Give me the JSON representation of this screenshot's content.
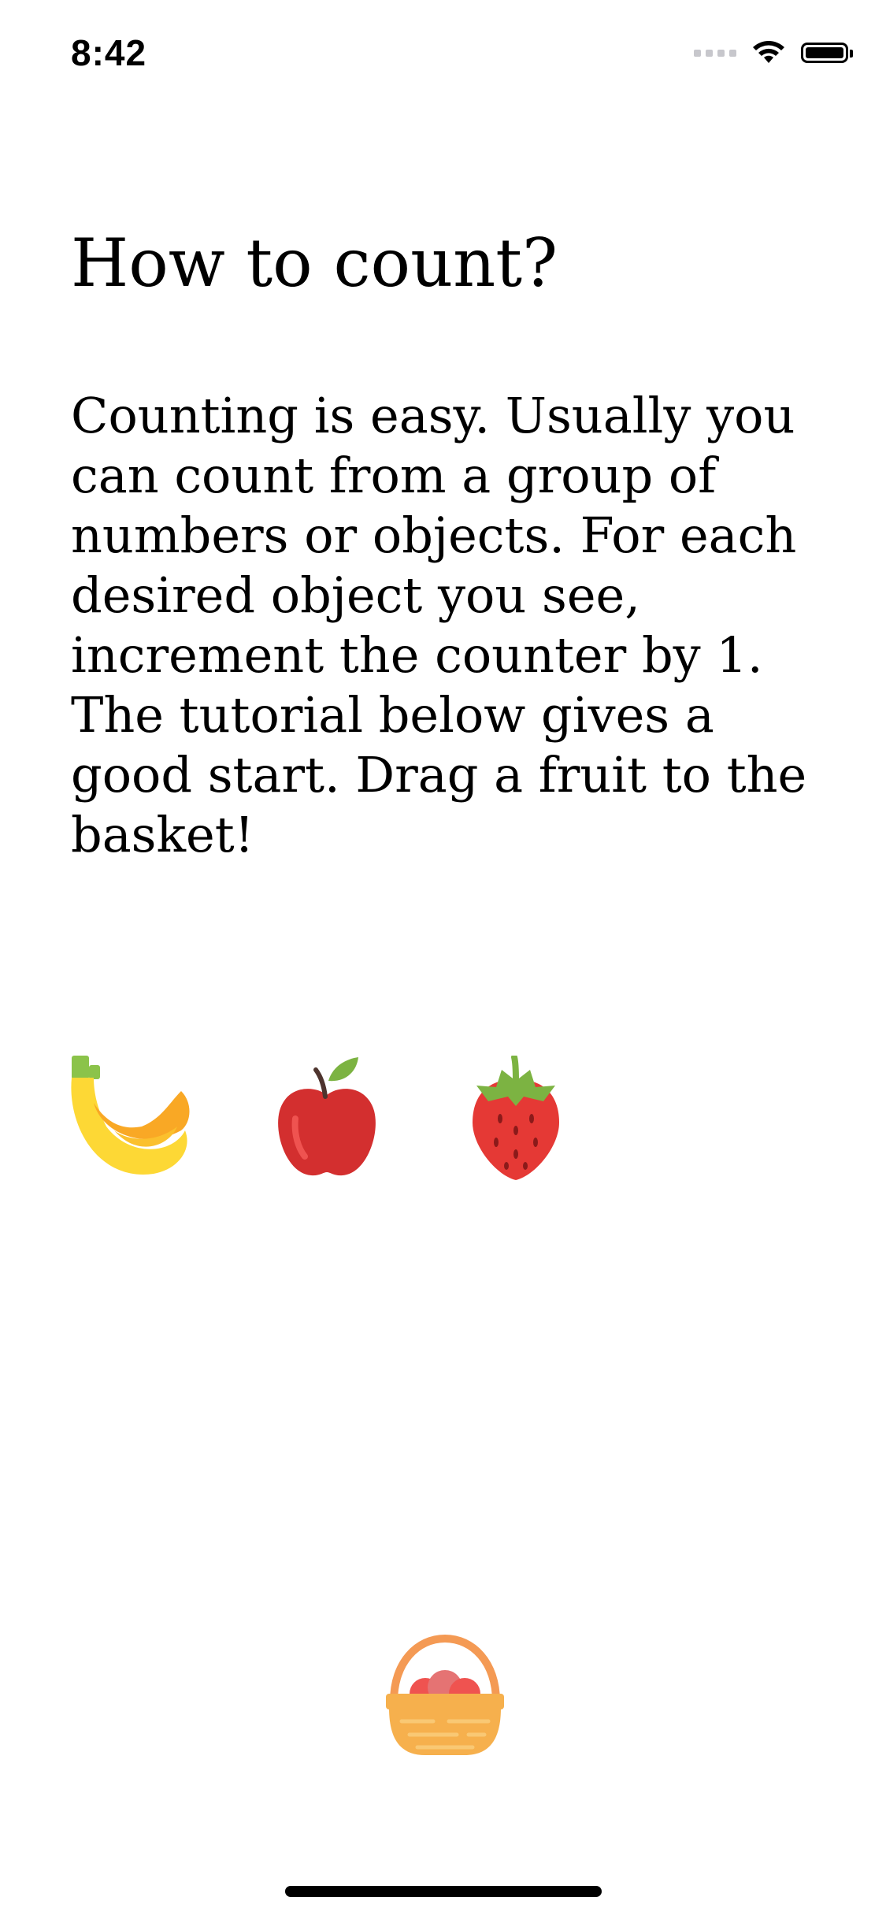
{
  "status_bar": {
    "time": "8:42",
    "icons": [
      "signal-dots-icon",
      "wifi-icon",
      "battery-icon"
    ]
  },
  "page": {
    "title": "How to count?",
    "body": "Counting is easy. Usually you can count from a group of numbers or objects. For each desired object you see, increment the counter by 1. The tutorial below gives a good start. Drag a fruit to the basket!"
  },
  "fruits": [
    {
      "name": "banana",
      "icon": "banana-icon"
    },
    {
      "name": "apple",
      "icon": "apple-icon"
    },
    {
      "name": "strawberry",
      "icon": "strawberry-icon"
    }
  ],
  "basket": {
    "icon": "basket-icon"
  },
  "colors": {
    "banana": "#fdd835",
    "banana_shade": "#f9a825",
    "banana_stem": "#8bc34a",
    "apple": "#d32f2f",
    "apple_leaf": "#7cb342",
    "strawberry": "#e53935",
    "strawberry_leaf": "#7cb342",
    "basket": "#f6b04d",
    "basket_handle": "#f49a54",
    "basket_fruit": "#ef5350"
  }
}
